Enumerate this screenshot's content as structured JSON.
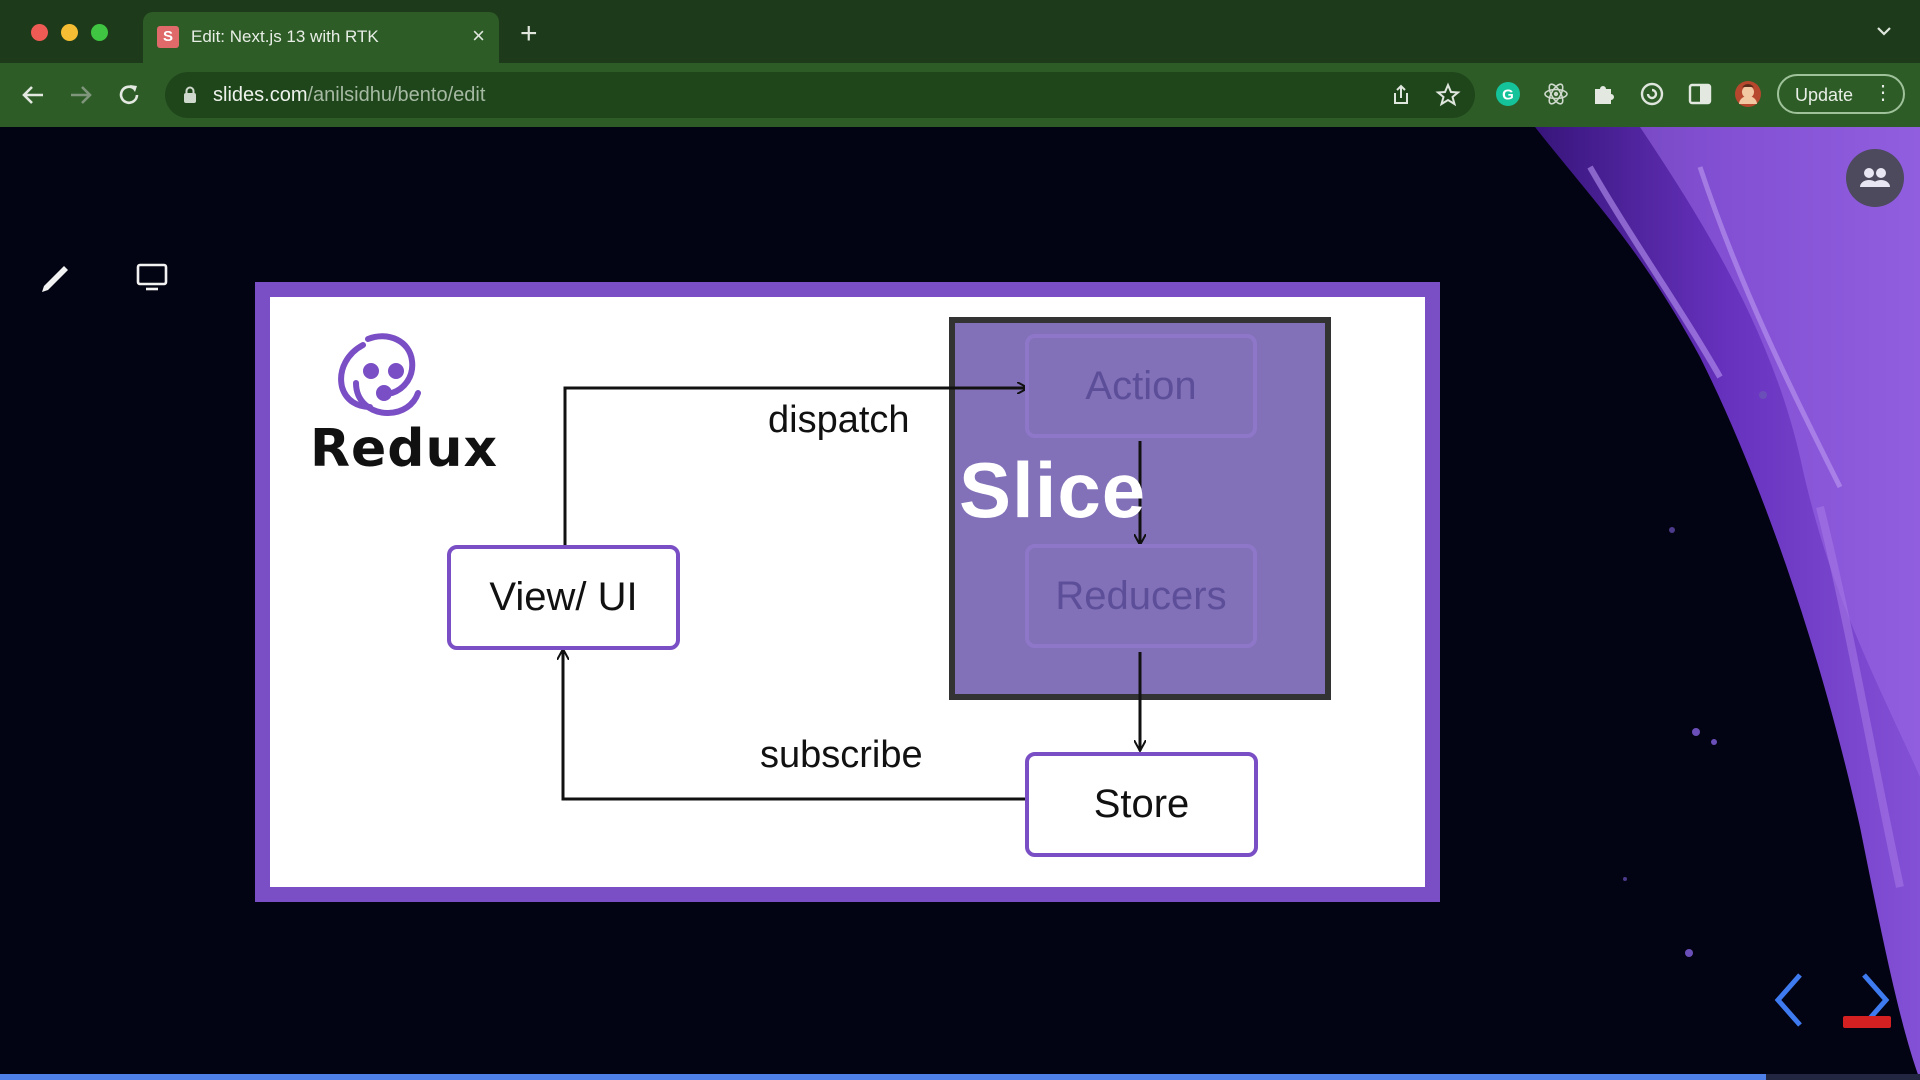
{
  "browser": {
    "tab": {
      "favicon_letter": "S",
      "title": "Edit: Next.js 13 with RTK"
    },
    "url": {
      "domain": "slides.com",
      "path": "/anilsidhu/bento/edit"
    },
    "update_label": "Update",
    "accent": "#2d5c27"
  },
  "slide": {
    "logo_text": "Redux",
    "slice_label": "Slice",
    "nodes": {
      "action": "Action",
      "reducers": "Reducers",
      "view": "View/ UI",
      "store": "Store"
    },
    "edges": {
      "dispatch": "dispatch",
      "subscribe": "subscribe"
    },
    "frame_color": "#7a4ec4"
  },
  "presentation": {
    "progress": 0.92
  }
}
